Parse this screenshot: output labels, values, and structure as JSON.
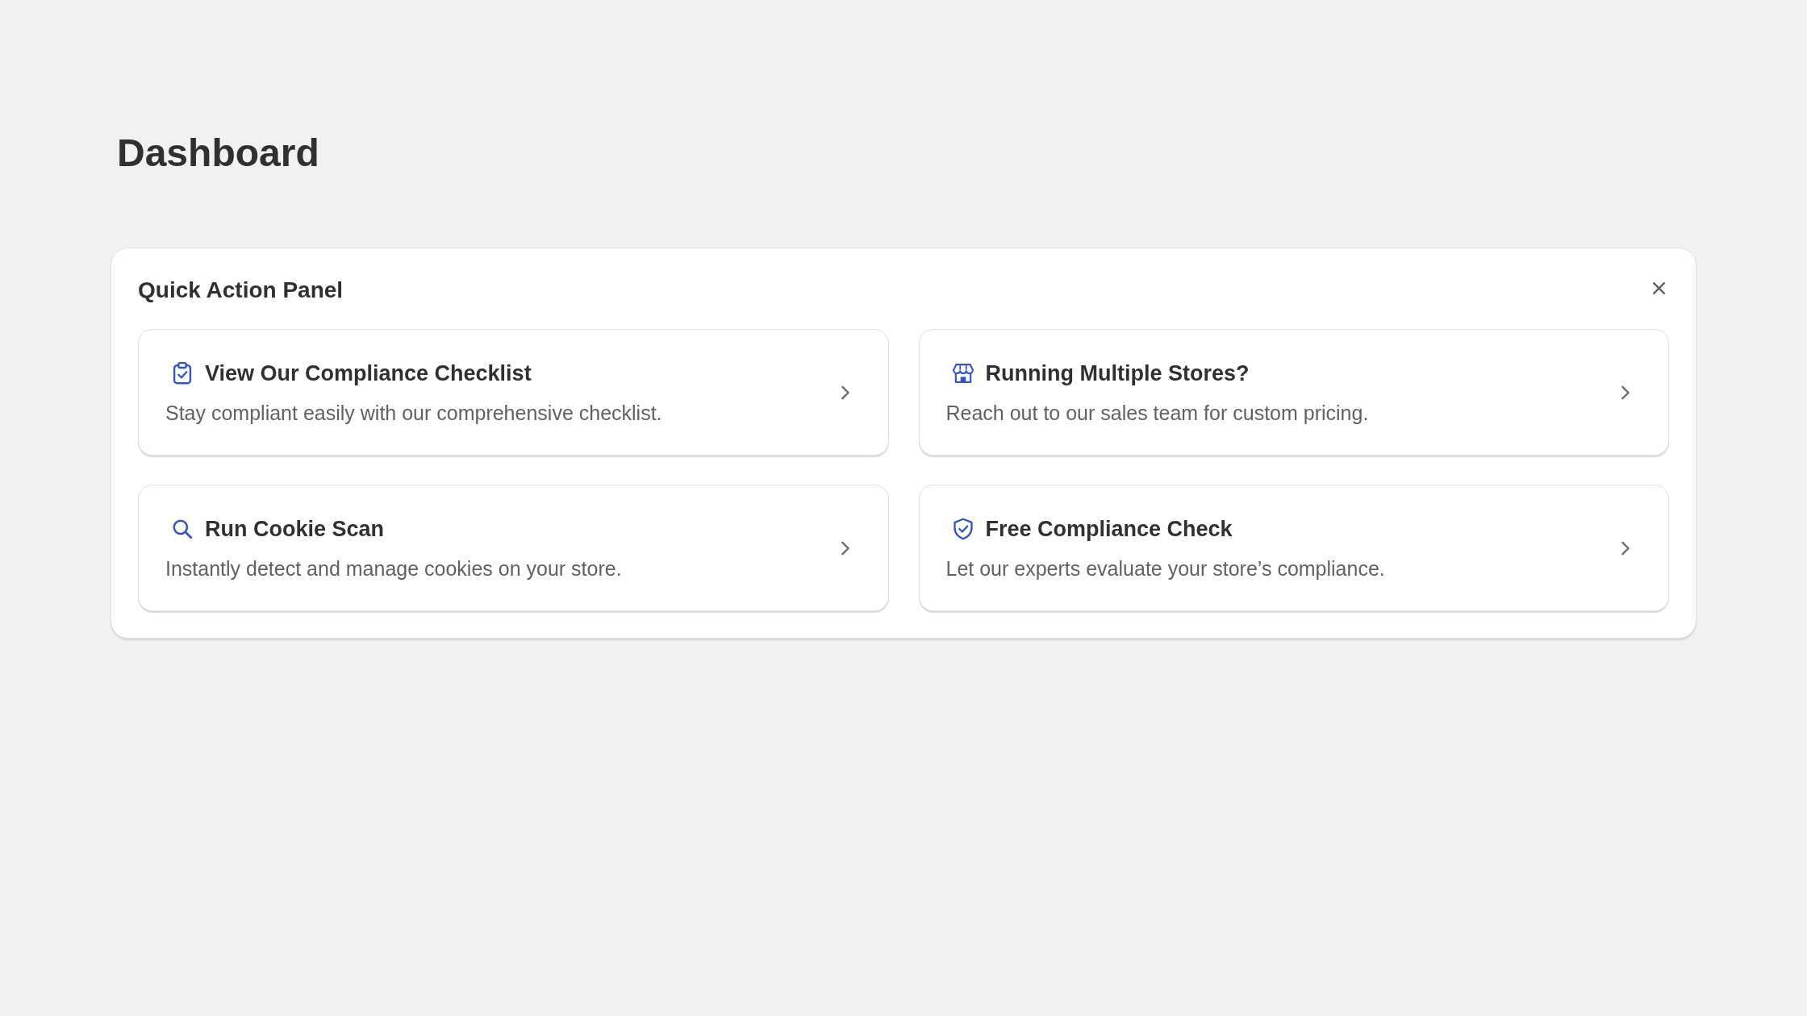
{
  "page": {
    "title": "Dashboard"
  },
  "quick_action_panel": {
    "title": "Quick Action Panel",
    "actions": [
      {
        "kind": "checklist",
        "title": "View Our Compliance Checklist",
        "description": "Stay compliant easily with our comprehensive checklist."
      },
      {
        "kind": "store",
        "title": "Running Multiple Stores?",
        "description": "Reach out to our sales team for custom pricing."
      },
      {
        "kind": "search",
        "title": "Run Cookie Scan",
        "description": "Instantly detect and manage cookies on your store."
      },
      {
        "kind": "shield",
        "title": "Free Compliance Check",
        "description": "Let our experts evaluate your store’s compliance."
      }
    ]
  }
}
